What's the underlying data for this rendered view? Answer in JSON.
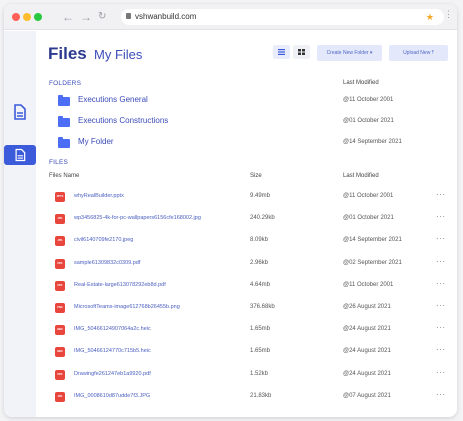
{
  "browser": {
    "url": "vshwanbuild.com"
  },
  "header": {
    "title": "Files",
    "subtitle": "My Files",
    "create_button": "Create New Folder",
    "upload_button": "Upload New"
  },
  "folders_section": {
    "label": "FOLDERS",
    "col_modified": "Last Modified",
    "items": [
      {
        "name": "Executions General",
        "modified": "@11 October 2001"
      },
      {
        "name": "Executions Constructions",
        "modified": "@01 October 2021"
      },
      {
        "name": "My Folder",
        "modified": "@14 September 2021"
      }
    ]
  },
  "files_section": {
    "label": "FILES",
    "col_name": "Files Name",
    "col_size": "Size",
    "col_modified": "Last Modified",
    "more": "···",
    "items": [
      {
        "type": "PPTX",
        "name": "whyRealBuilder.pptx",
        "size": "9.49mb",
        "modified": "@11 October 2001"
      },
      {
        "type": "JPG",
        "name": "wp3456825-4k-for-pc-wallpapers6156cfe168002.jpg",
        "size": "240.29kb",
        "modified": "@01 October 2021"
      },
      {
        "type": "JPG",
        "name": "civil6140709fe2170.jpeg",
        "size": "8.09kb",
        "modified": "@14 September 2021"
      },
      {
        "type": "PDF",
        "name": "sample61309832c0309.pdf",
        "size": "2.96kb",
        "modified": "@02 September 2021"
      },
      {
        "type": "PDF",
        "name": "Real-Estate-large613078292eb8d.pdf",
        "size": "4.64mb",
        "modified": "@11 October 2001"
      },
      {
        "type": "PNG",
        "name": "MicrosoftTeams-image612768b26455b.png",
        "size": "376.68kb",
        "modified": "@26 August 2021"
      },
      {
        "type": "HEIC",
        "name": "IMG_50466124907064a2c.heic",
        "size": "1.65mb",
        "modified": "@24 August 2021"
      },
      {
        "type": "HEIC",
        "name": "IMG_50466124770c715b5.heic",
        "size": "1.65mb",
        "modified": "@24 August 2021"
      },
      {
        "type": "PDF",
        "name": "Drawingfe261247eb1a9920.pdf",
        "size": "1.52kb",
        "modified": "@24 August 2021"
      },
      {
        "type": "JPG",
        "name": "IMG_0008610d87udde7f3.JPG",
        "size": "21.83kb",
        "modified": "@07 August 2021"
      }
    ]
  },
  "colors": {
    "accent": "#3b5bdb",
    "file_badge": "#e8453c",
    "folder": "#4c6ef5"
  }
}
